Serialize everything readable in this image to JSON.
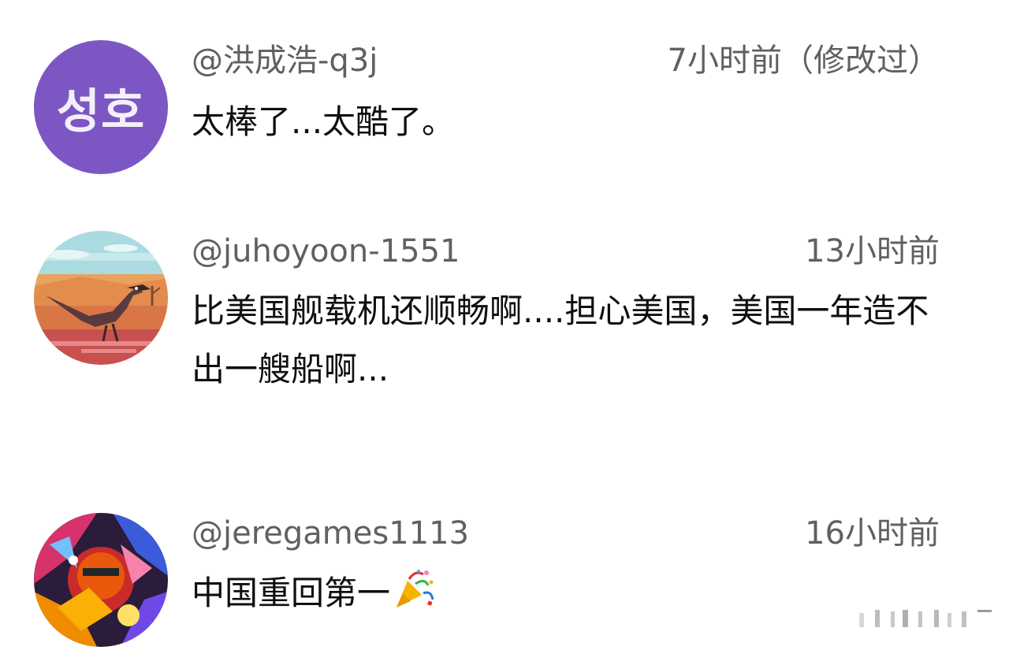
{
  "comments": [
    {
      "avatar_text": "성호",
      "avatar_color": "#7c57c4",
      "handle": "@洪成浩-q3j",
      "time": "7小时前（修改过）",
      "text": "太棒了...太酷了。"
    },
    {
      "avatar_icon": "roadrunner-desert-avatar",
      "handle": "@juhoyoon-1551",
      "time": "13小时前",
      "text": "比美国舰载机还顺畅啊....担心美国，美国一年造不出一艘船啊..."
    },
    {
      "avatar_icon": "colorful-character-avatar",
      "handle": "@jeregames1113",
      "time": "16小时前",
      "text": "中国重回第一",
      "emoji_icon": "party-popper-icon"
    }
  ],
  "colors": {
    "handle_gray": "#606060",
    "text_black": "#0f0f0f"
  }
}
